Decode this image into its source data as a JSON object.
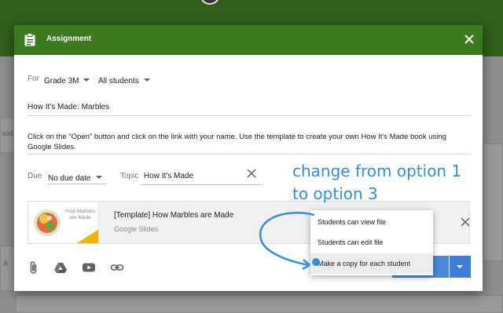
{
  "header": {
    "title": "Assignment"
  },
  "for_row": {
    "label": "For",
    "class_value": "Grade 3M",
    "students_value": "All students"
  },
  "assignment_title": "How It's Made: Marbles",
  "description": "Click on the \"Open\" button and click on the link with your name. Use the template to create your own How It's Made book using Google Slides.",
  "due": {
    "label": "Due",
    "value": "No due date"
  },
  "topic": {
    "label": "Topic",
    "value": "How It's Made"
  },
  "attachment": {
    "thumbnail_text": "How Marbles are Made",
    "title": "[Template] How Marbles are Made",
    "subtitle": "Google Slides"
  },
  "share_menu": {
    "options": [
      "Students can view file",
      "Students can edit file",
      "Make a copy for each student"
    ],
    "selected_index": 2
  },
  "annotation": {
    "line1": "change from option 1",
    "line2": "to option 3",
    "color": "#2f8fe0"
  },
  "background": {
    "left_text_1": "sod",
    "left_text_2": "A"
  },
  "colors": {
    "header": "#3b7a1e",
    "assign_button": "#4a89dc"
  }
}
